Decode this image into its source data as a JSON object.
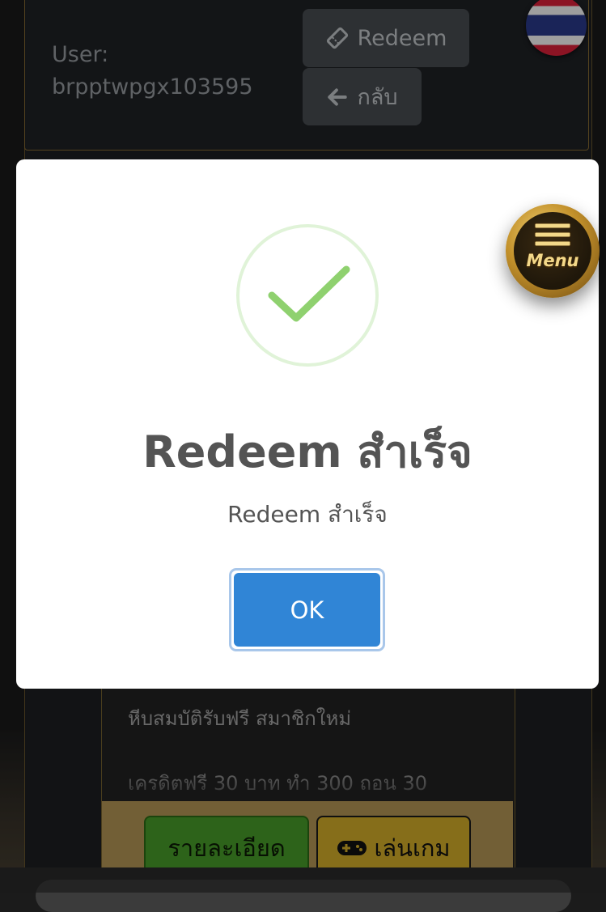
{
  "header": {
    "user_label": "User:",
    "username": "brpptwpgx103595",
    "redeem_button": "Redeem",
    "back_button": "กลับ"
  },
  "promo": {
    "title": "หีบสมบัติรับฟรี สมาชิกใหม่",
    "detail": "เครดิตฟรี 30 บาท ทำ 300 ถอน 30",
    "details_button": "รายละเอียด",
    "play_button": "เล่นเกม"
  },
  "modal": {
    "title": "Redeem สำเร็จ",
    "text": "Redeem สำเร็จ",
    "ok_button": "OK"
  },
  "floating_menu": {
    "label": "Menu"
  },
  "colors": {
    "ok_blue": "#3085d6",
    "success_green": "#8fd16f",
    "details_green": "#4aa12a",
    "play_gold": "#d8b22a"
  },
  "icons": [
    "ticket-icon",
    "arrow-left-icon",
    "thailand-flag-icon",
    "success-check-icon",
    "hamburger-icon",
    "gamepad-icon"
  ]
}
